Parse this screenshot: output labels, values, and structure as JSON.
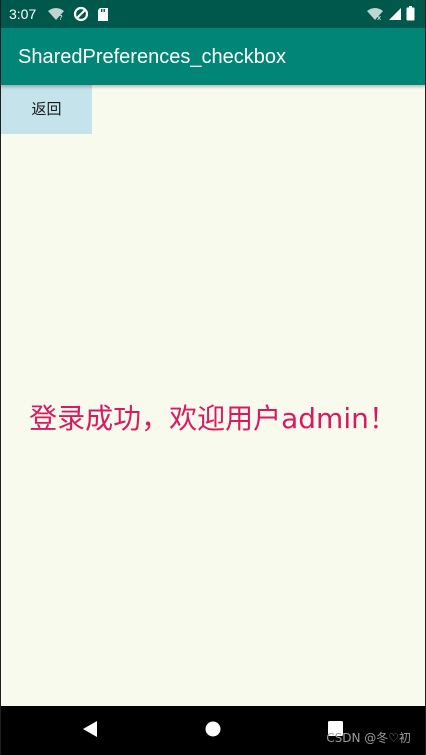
{
  "status_bar": {
    "time": "3:07",
    "left_icons": [
      "wifi-unknown-icon",
      "data-saver-icon",
      "sd-card-icon"
    ],
    "right_icons": [
      "wifi-no-internet-icon",
      "signal-icon",
      "battery-icon"
    ]
  },
  "app_bar": {
    "title": "SharedPreferences_checkbox"
  },
  "main": {
    "back_button_label": "返回",
    "welcome_message": "登录成功，欢迎用户admin！"
  },
  "navigation_bar": {
    "buttons": [
      "back-triangle-icon",
      "home-circle-icon",
      "recents-square-icon"
    ]
  },
  "watermark": "CSDN @冬♡初",
  "colors": {
    "status_bar": "#00574b",
    "app_bar": "#008577",
    "content_background": "#f8faee",
    "back_button_background": "#c4e3ea",
    "welcome_text": "#d81b60",
    "nav_bar": "#000000"
  }
}
